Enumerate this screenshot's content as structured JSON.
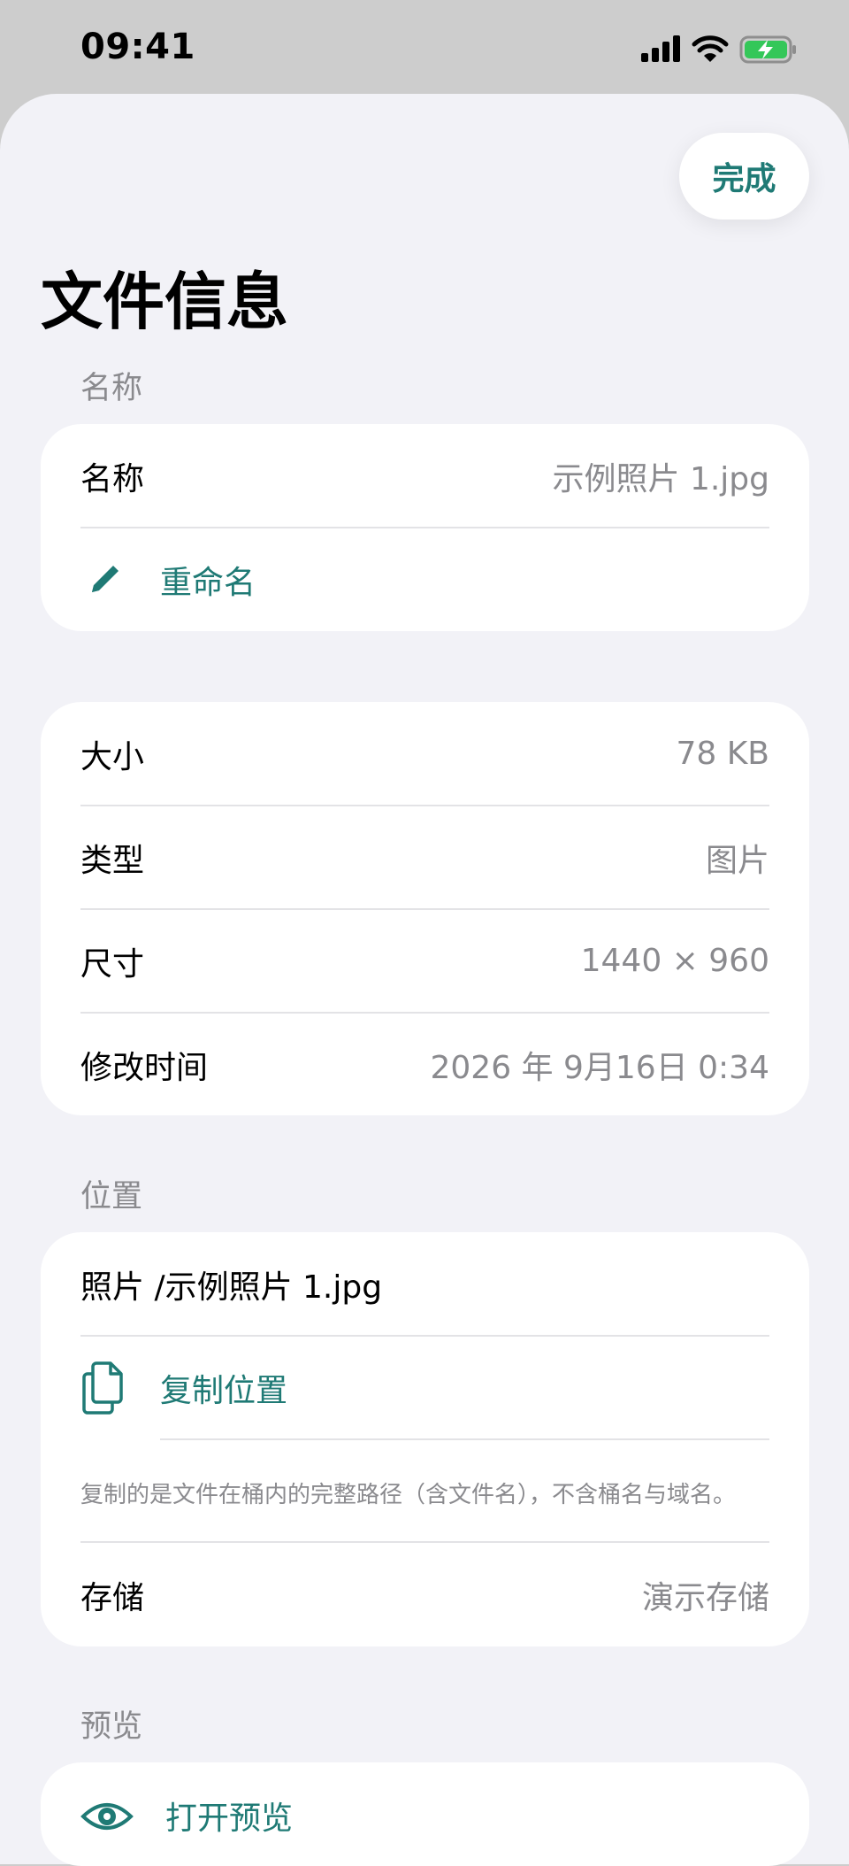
{
  "status": {
    "time": "09:41"
  },
  "header": {
    "done_label": "完成",
    "title": "文件信息"
  },
  "name_section": {
    "header": "名称",
    "name_label": "名称",
    "name_value": "示例照片 1.jpg",
    "rename_label": "重命名"
  },
  "details": {
    "size_label": "大小",
    "size_value": "78 KB",
    "type_label": "类型",
    "type_value": "图片",
    "dims_label": "尺寸",
    "dims_value": "1440 × 960",
    "modified_label": "修改时间",
    "modified_value": "2026 年 9月16日 0:34"
  },
  "location_section": {
    "header": "位置",
    "path": "照片 /示例照片 1.jpg",
    "copy_label": "复制位置",
    "note": "复制的是文件在桶内的完整路径（含文件名），不含桶名与域名。",
    "storage_label": "存储",
    "storage_value": "演示存储"
  },
  "preview_section": {
    "header": "预览",
    "open_label": "打开预览"
  },
  "colors": {
    "accent": "#1f7a75",
    "background": "#f2f2f7",
    "secondary_text": "#8a8a8e"
  }
}
